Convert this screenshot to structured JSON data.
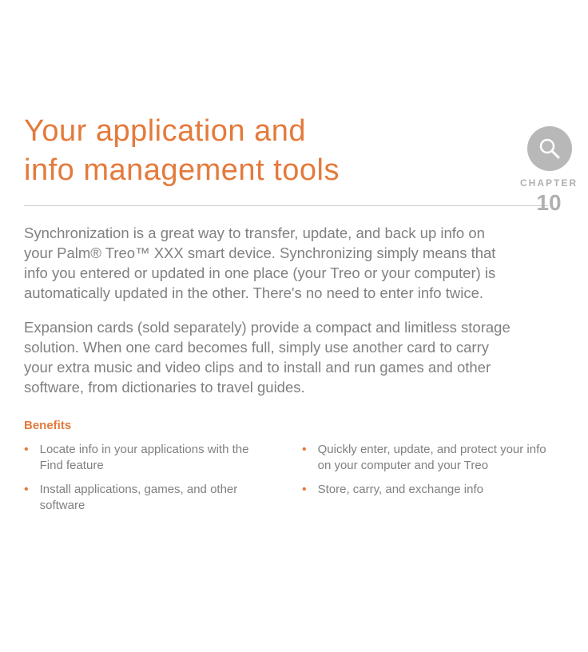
{
  "header": {
    "chapter_word": "CHAPTER",
    "chapter_number": "10"
  },
  "title_line1": "Your application and",
  "title_line2": "info management tools",
  "intro1": "Synchronization is a great way to transfer, update, and back up info on your Palm® Treo™ XXX smart device. Synchronizing simply means that info you entered or updated in one place (your Treo or your computer) is automatically updated in the other. There's no need to enter info twice.",
  "intro2": "Expansion cards (sold separately) provide a compact and limitless storage solution. When one card becomes full, simply use another card to carry your extra music and video clips and to install and run games and other software, from dictionaries to travel guides.",
  "benefits_heading": "Benefits",
  "benefits": {
    "left": [
      "Locate info in your applications with the Find feature",
      "Install applications, games, and other software"
    ],
    "right": [
      "Quickly enter, update, and protect your info on your computer and your Treo",
      "Store, carry, and exchange info"
    ]
  }
}
